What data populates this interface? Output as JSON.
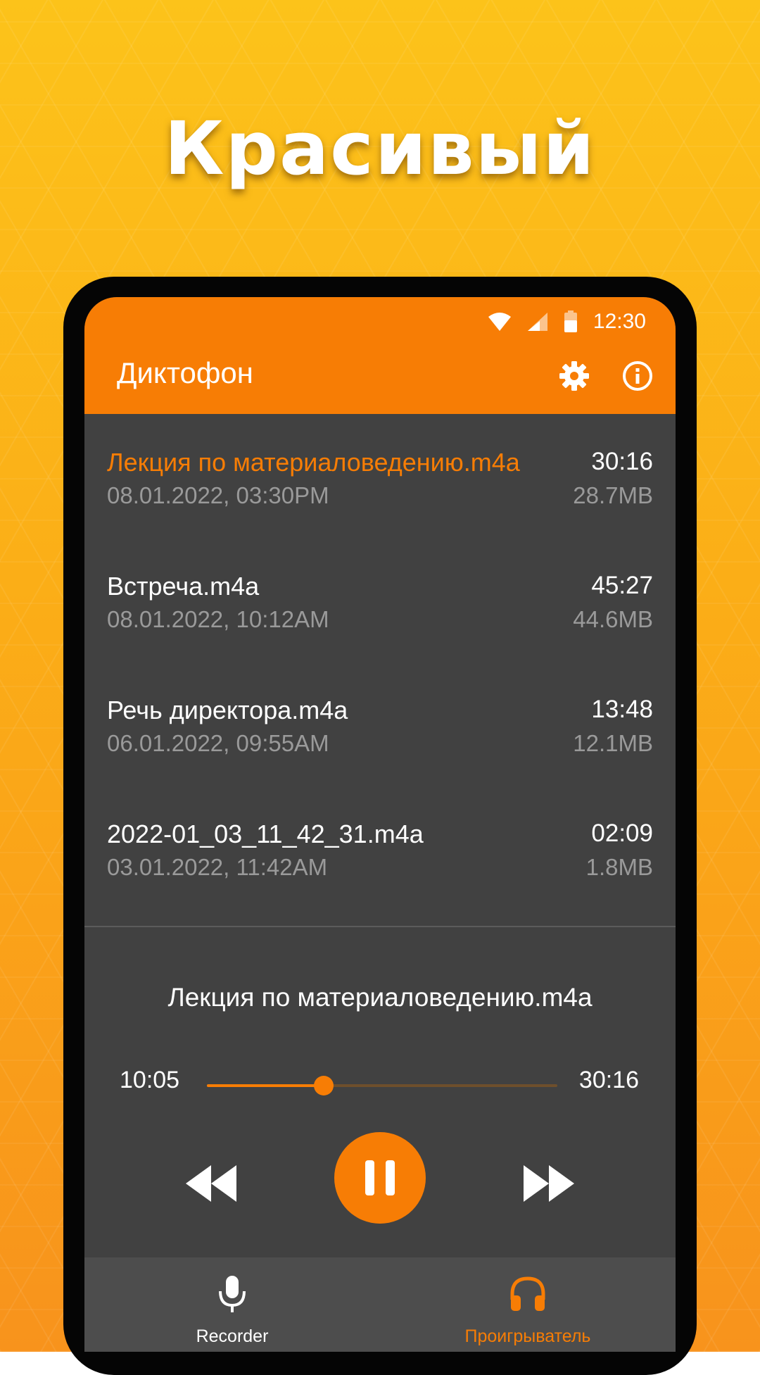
{
  "promo": {
    "headline": "Красивый"
  },
  "status_bar": {
    "time": "12:30",
    "icons": [
      "wifi-icon",
      "cellular-signal-icon",
      "battery-icon"
    ]
  },
  "app_bar": {
    "title": "Диктофон",
    "actions": [
      "settings-icon",
      "info-icon"
    ]
  },
  "recordings": [
    {
      "name": "Лекция по материаловедению.m4a",
      "date": "08.01.2022, 03:30PM",
      "duration": "30:16",
      "size": "28.7MB",
      "active": true
    },
    {
      "name": "Встреча.m4a",
      "date": "08.01.2022, 10:12AM",
      "duration": "45:27",
      "size": "44.6MB",
      "active": false
    },
    {
      "name": "Речь директора.m4a",
      "date": "06.01.2022, 09:55AM",
      "duration": "13:48",
      "size": "12.1MB",
      "active": false
    },
    {
      "name": "2022-01_03_11_42_31.m4a",
      "date": "03.01.2022, 11:42AM",
      "duration": "02:09",
      "size": "1.8MB",
      "active": false
    }
  ],
  "player": {
    "track_title": "Лекция по материаловедению.m4a",
    "current_time": "10:05",
    "total_time": "30:16",
    "progress_fraction": 0.333,
    "controls": [
      "rewind-icon",
      "pause-icon",
      "fast-forward-icon"
    ]
  },
  "bottom_nav": {
    "items": [
      {
        "label": "Recorder",
        "icon": "microphone-icon",
        "selected": false
      },
      {
        "label": "Проигрыватель",
        "icon": "headphones-icon",
        "selected": true
      }
    ]
  },
  "colors": {
    "accent": "#f77d05",
    "background_yellow": "#fbb316",
    "surface_dark": "#414141",
    "nav_surface": "#4d4d4d",
    "secondary_text": "#9a9a9a"
  }
}
